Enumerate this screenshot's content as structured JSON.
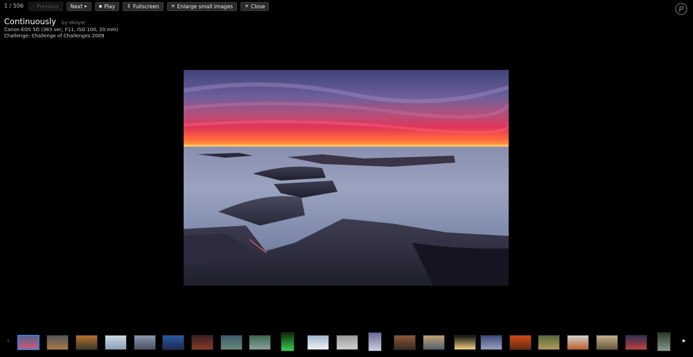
{
  "toolbar": {
    "counter": "1 / 506",
    "previous_label": "Previous",
    "next_label": "Next",
    "play_label": "Play",
    "fullscreen_label": "Fullscreen",
    "enlarge_label": "Enlarge small images",
    "close_label": "Close"
  },
  "photo": {
    "title": "Continuously",
    "author": "by ekoyie",
    "camera": "Canon EOS 5D (383 sec, F11, ISO 100, 20 mm)",
    "challenge": "Challenge: Challenge of Challenges 2009"
  },
  "thumbnails": [
    {
      "icon": "seascape-sunset-thumbnail",
      "colors": [
        "#5a5f8a",
        "#d05a7a"
      ]
    },
    {
      "icon": "sky-landscape-thumbnail",
      "colors": [
        "#555",
        "#a87a4a"
      ]
    },
    {
      "icon": "butterfly-thumbnail",
      "colors": [
        "#b8702a",
        "#3a3a2a"
      ]
    },
    {
      "icon": "white-bird-thumbnail",
      "colors": [
        "#cfd8e0",
        "#8aa0b8"
      ]
    },
    {
      "icon": "shore-thumbnail",
      "colors": [
        "#8a98b0",
        "#4a5060"
      ]
    },
    {
      "icon": "blue-lake-thumbnail",
      "colors": [
        "#2a5aa0",
        "#1a2a50"
      ]
    },
    {
      "icon": "red-rocks-thumbnail",
      "colors": [
        "#3a2020",
        "#8a3a2a"
      ]
    },
    {
      "icon": "mountain-lake-thumbnail",
      "colors": [
        "#3a5a6a",
        "#6a8a7a"
      ]
    },
    {
      "icon": "green-valley-thumbnail",
      "colors": [
        "#3a6a4a",
        "#8aa0a0"
      ]
    },
    {
      "icon": "aurora-thumbnail",
      "colors": [
        "#0a2a0a",
        "#3ad04a"
      ]
    },
    {
      "icon": "ice-thumbnail",
      "colors": [
        "#a0b8d0",
        "#f0f0f0"
      ]
    },
    {
      "icon": "grey-scene-thumbnail",
      "colors": [
        "#9a9a9a",
        "#d0d0d0"
      ]
    },
    {
      "icon": "purple-portrait-thumbnail",
      "colors": [
        "#6a6a9a",
        "#cfcfe0"
      ]
    },
    {
      "icon": "brick-building-thumbnail",
      "colors": [
        "#8a5a3a",
        "#3a2a20"
      ]
    },
    {
      "icon": "beach-horizon-thumbnail",
      "colors": [
        "#c0a070",
        "#506070"
      ]
    },
    {
      "icon": "lantern-night-thumbnail",
      "colors": [
        "#101010",
        "#f0d080"
      ]
    },
    {
      "icon": "dusk-water-thumbnail",
      "colors": [
        "#3a4a7a",
        "#9aa0c0"
      ]
    },
    {
      "icon": "autumn-trees-thumbnail",
      "colors": [
        "#d04a1a",
        "#6a2a10"
      ]
    },
    {
      "icon": "forest-path-thumbnail",
      "colors": [
        "#5a6a3a",
        "#b09a5a"
      ]
    },
    {
      "icon": "orange-creature-thumbnail",
      "colors": [
        "#d0d0d0",
        "#c0602a"
      ]
    },
    {
      "icon": "bird-flight-thumbnail",
      "colors": [
        "#c0b090",
        "#6a5a3a"
      ]
    },
    {
      "icon": "cyclist-thumbnail",
      "colors": [
        "#303050",
        "#c04040"
      ]
    },
    {
      "icon": "dark-figure-thumbnail",
      "colors": [
        "#2a3a2a",
        "#8a9a8a"
      ]
    }
  ]
}
